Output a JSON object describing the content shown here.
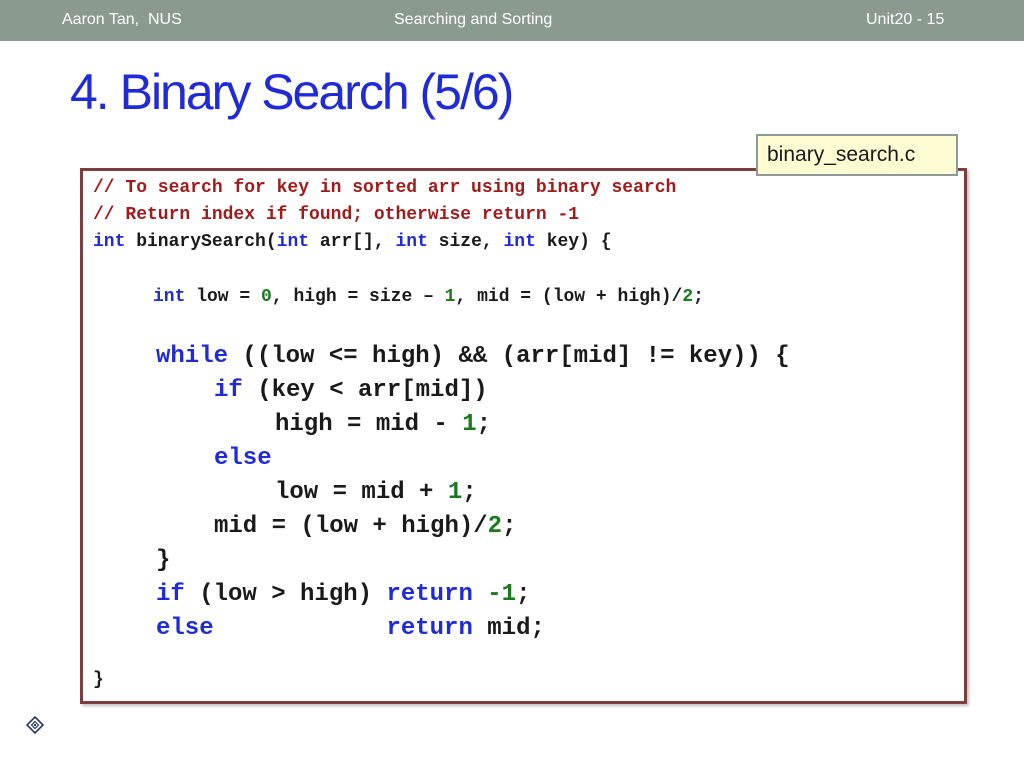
{
  "header": {
    "author": "Aaron Tan,  NUS",
    "topic": "Searching and Sorting",
    "unit": "Unit20 - 15"
  },
  "slide": {
    "title": "4. Binary Search (5/6)",
    "filename": "binary_search.c"
  },
  "code": {
    "l1": {
      "t0": "// To search for key in sorted arr using binary search"
    },
    "l2": {
      "t0": "// Return index if found; otherwise return -1"
    },
    "l3": {
      "t0": "int",
      "t1": " binarySearch(",
      "t2": "int",
      "t3": " arr[], ",
      "t4": "int",
      "t5": " size, ",
      "t6": "int",
      "t7": " key) {"
    },
    "l4": {
      "t0": "int",
      "t1": " low = ",
      "t2": "0",
      "t3": ", high = size – ",
      "t4": "1",
      "t5": ", mid = (low + high)/",
      "t6": "2",
      "t7": ";"
    },
    "l5": {
      "t0": "while",
      "t1": " ((low <= high) && (arr[mid] != key)) {"
    },
    "l6": {
      "t0": "if",
      "t1": " (key < arr[mid])"
    },
    "l7": {
      "t0": "high = mid - ",
      "t1": "1",
      "t2": ";"
    },
    "l8": {
      "t0": "else"
    },
    "l9": {
      "t0": "low = mid + ",
      "t1": "1",
      "t2": ";"
    },
    "l10": {
      "t0": "mid = (low + high)/",
      "t1": "2",
      "t2": ";"
    },
    "l11": {
      "t0": "}"
    },
    "l12": {
      "t0": "if",
      "t1": " (low > high) ",
      "t2": "return",
      "t3": " ",
      "t4": "-1",
      "t5": ";"
    },
    "l13": {
      "t0": "else",
      "t1": "            ",
      "t2": "return",
      "t3": " mid;"
    },
    "l14": {
      "t0": "}"
    }
  },
  "colors": {
    "header_bar": "#8b9a8f",
    "title": "#1f2bd6",
    "comment": "#a11b1b",
    "keyword": "#1f2bd6",
    "number": "#1c7a1c",
    "code_border": "#7b3f3f",
    "filename_bg": "#fffbd3"
  },
  "icons": {
    "footer": "diamond-target-icon"
  }
}
